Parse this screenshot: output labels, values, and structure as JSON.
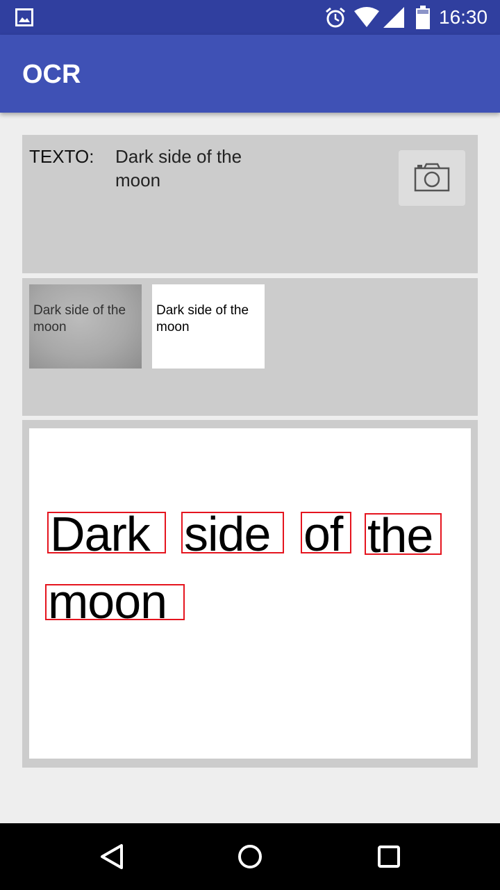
{
  "status_bar": {
    "time": "16:30",
    "icons": [
      "gallery-icon",
      "alarm-icon",
      "wifi-icon",
      "signal-icon",
      "battery-icon"
    ],
    "background": "#303f9f"
  },
  "app_bar": {
    "title": "OCR",
    "background": "#3f51b5"
  },
  "text_panel": {
    "label": "TEXTO:",
    "value": "Dark side of the moon",
    "camera_icon": "camera-icon"
  },
  "thumbnails": {
    "original_text": "Dark side of the moon",
    "binarized_text": "Dark side of the moon"
  },
  "result": {
    "words": [
      "Dark",
      "side",
      "of",
      "the",
      "moon"
    ],
    "box_color": "#e5141e"
  },
  "nav_bar": {
    "icons": [
      "back-icon",
      "home-icon",
      "recents-icon"
    ]
  }
}
